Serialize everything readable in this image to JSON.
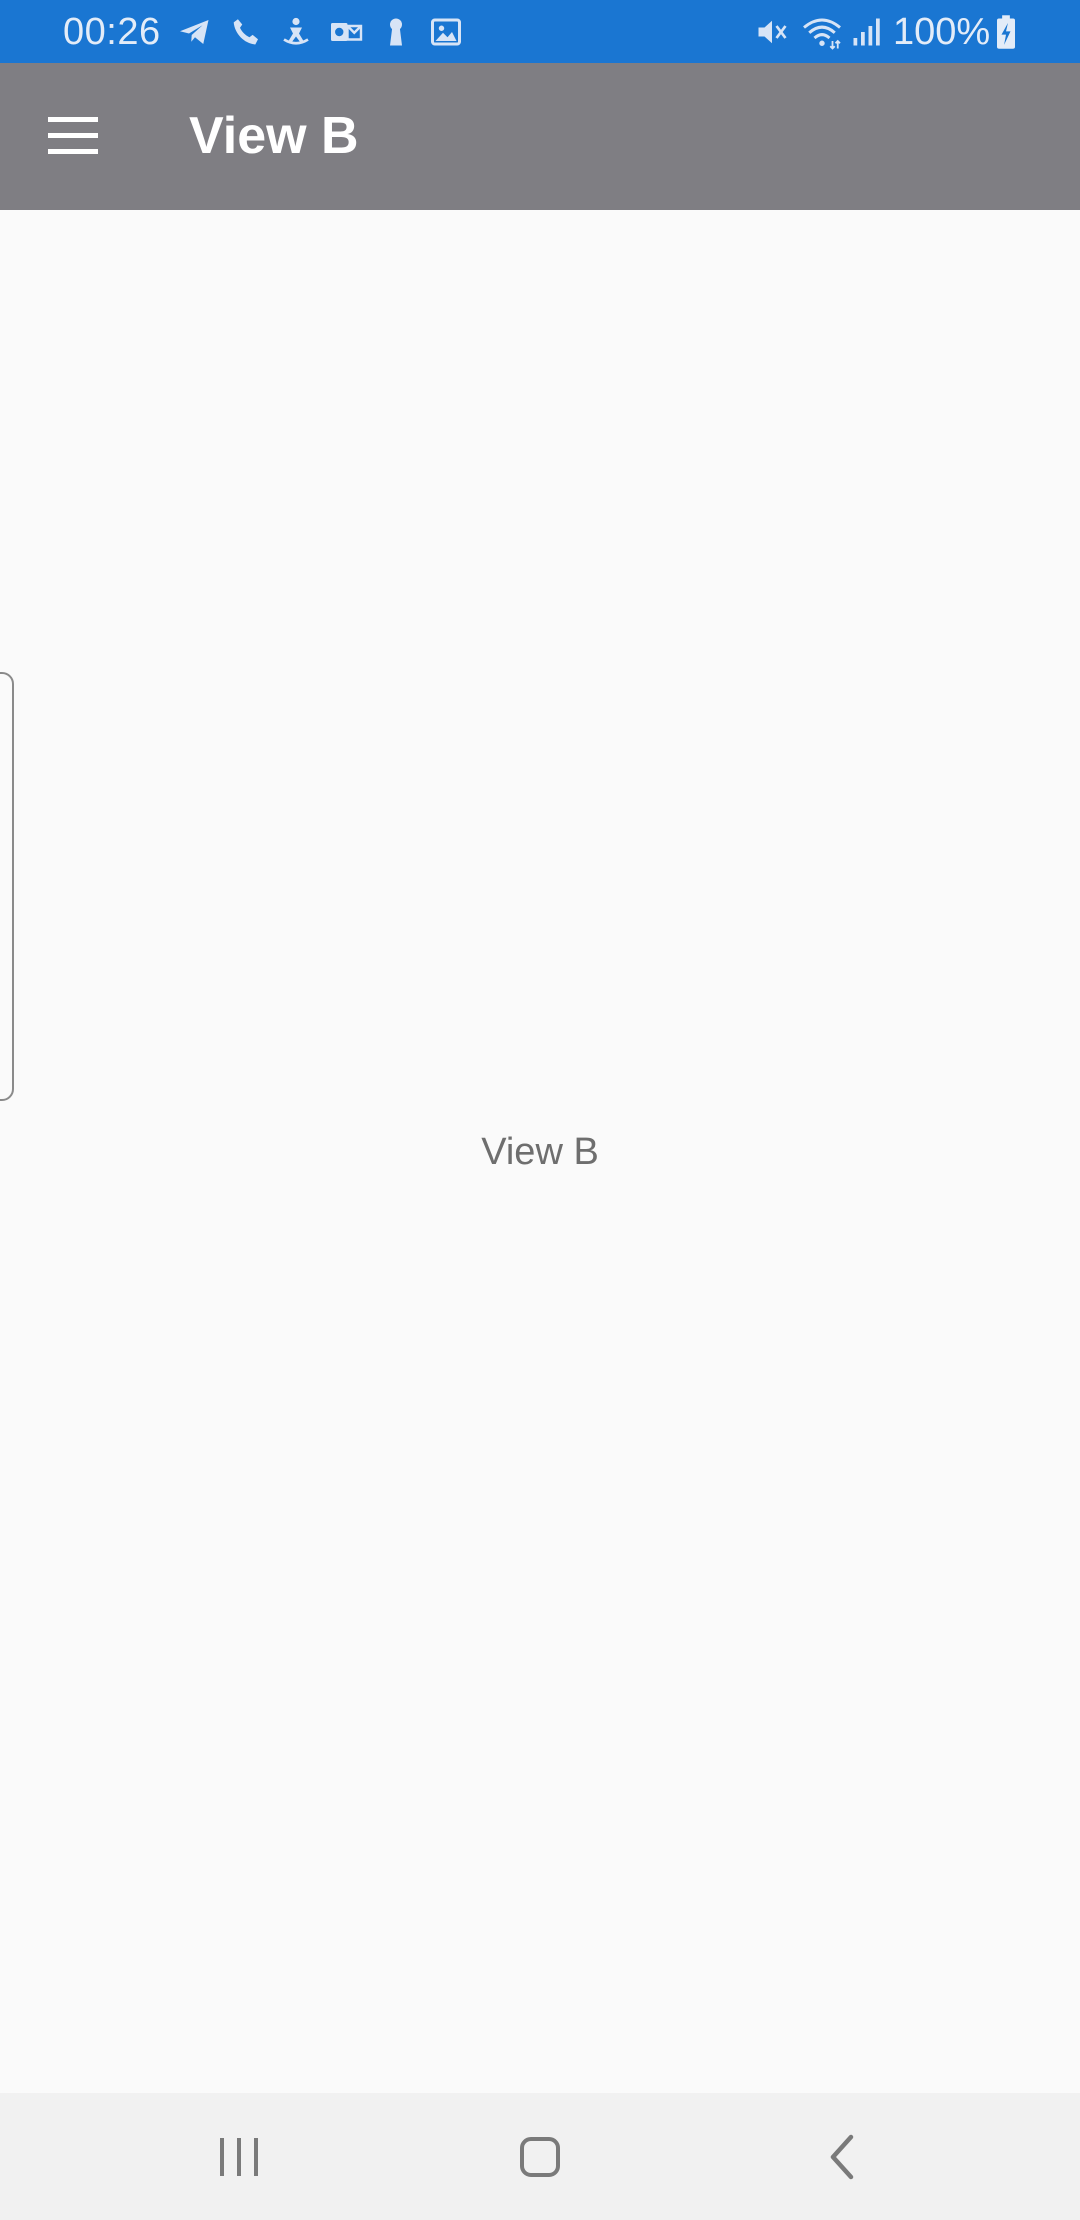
{
  "status_bar": {
    "time": "00:26",
    "battery_level": "100%",
    "background_color": "#1a76d2",
    "notification_icons": [
      "telegram-icon",
      "phone-icon",
      "accessibility-icon",
      "outlook-icon",
      "keyhole-icon",
      "image-icon"
    ],
    "system_icons": [
      "mute-icon",
      "wifi-icon",
      "signal-icon",
      "battery-charging-icon"
    ]
  },
  "app_bar": {
    "title": "View B",
    "menu_icon": "hamburger-menu-icon",
    "background_color": "#7f7e83"
  },
  "content": {
    "label": "View B"
  },
  "nav_bar": {
    "buttons": [
      "recent-apps-icon",
      "home-icon",
      "back-icon"
    ]
  }
}
